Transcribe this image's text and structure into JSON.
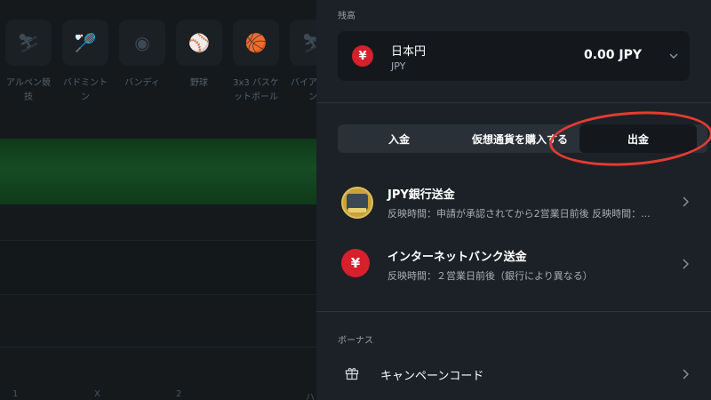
{
  "background": {
    "sports": [
      {
        "label": "アルペン競技",
        "icon": "skier-icon"
      },
      {
        "label": "バドミントン",
        "icon": "badminton-icon"
      },
      {
        "label": "バンディ",
        "icon": "bandy-icon"
      },
      {
        "label": "野球",
        "icon": "baseball-icon"
      },
      {
        "label": "3x3 バスケットボール",
        "icon": "basketball-icon"
      },
      {
        "label": "バイアスロン",
        "icon": "biathlon-icon"
      }
    ],
    "odds_headers": [
      "1",
      "X",
      "2",
      "ハ"
    ]
  },
  "panel": {
    "balance_label": "残高",
    "currency": {
      "name": "日本円",
      "code": "JPY",
      "symbol": "¥",
      "amount": "0.00 JPY"
    },
    "tabs": [
      {
        "label": "入金",
        "active": false
      },
      {
        "label": "仮想通貨を購入する",
        "active": false
      },
      {
        "label": "出金",
        "active": true
      }
    ],
    "methods": [
      {
        "title": "JPY銀行送金",
        "subtitle": "反映時間：申請が承認されてから2営業日前後 反映時間：...",
        "icon": "bank-transfer-icon"
      },
      {
        "title": "インターネットバンク送金",
        "subtitle": "反映時間：２営業日前後（銀行により異なる）",
        "icon": "yen-icon",
        "symbol": "¥"
      }
    ],
    "bonus_label": "ボーナス",
    "promo_label": "キャンペーンコード"
  },
  "colors": {
    "accent_red": "#d6202b",
    "annotation_red": "#e53b32",
    "panel_bg": "#1c2127"
  }
}
